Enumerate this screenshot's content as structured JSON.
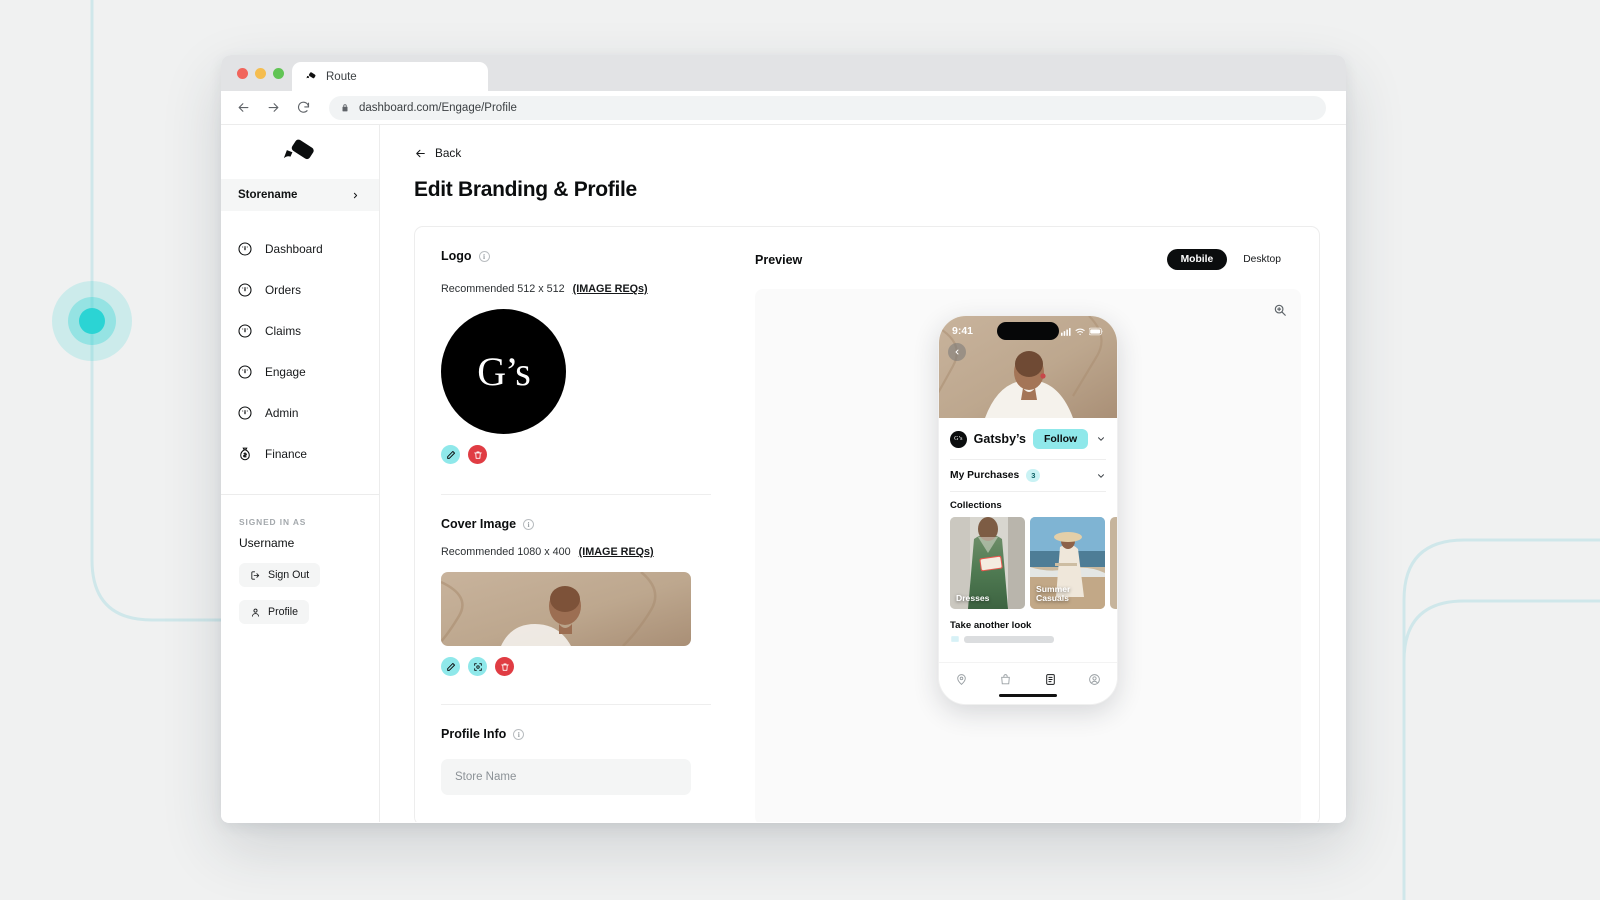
{
  "browser": {
    "tab_title": "Route",
    "tab_favicon": "route-logo-icon",
    "url": "dashboard.com/Engage/Profile",
    "nav": {
      "back": "back-arrow-icon",
      "forward": "forward-arrow-icon",
      "reload": "reload-icon",
      "lock": "lock-icon"
    },
    "traffic_lights": [
      "close",
      "minimize",
      "maximize"
    ]
  },
  "sidebar": {
    "brand_icon": "route-logo-icon",
    "store": {
      "label": "Storename",
      "chevron": "chevron-right-icon"
    },
    "items": [
      {
        "label": "Dashboard",
        "icon": "gauge-icon"
      },
      {
        "label": "Orders",
        "icon": "gauge-icon"
      },
      {
        "label": "Claims",
        "icon": "gauge-icon"
      },
      {
        "label": "Engage",
        "icon": "gauge-icon"
      },
      {
        "label": "Admin",
        "icon": "gauge-icon"
      },
      {
        "label": "Finance",
        "icon": "money-bag-icon"
      }
    ],
    "signed_in_label": "SIGNED IN AS",
    "username": "Username",
    "sign_out": "Sign Out",
    "profile": "Profile"
  },
  "main": {
    "back": "Back",
    "title": "Edit Branding & Profile"
  },
  "logo_section": {
    "title": "Logo",
    "recommended": "Recommended 512 x 512",
    "req_link": "(IMAGE REQs)",
    "logo_text": "G’s",
    "actions": [
      {
        "name": "edit-logo-button",
        "icon": "pencil-icon",
        "color": "#8fe8ea"
      },
      {
        "name": "delete-logo-button",
        "icon": "trash-icon",
        "color": "#e03c43"
      }
    ]
  },
  "cover_section": {
    "title": "Cover Image",
    "recommended": "Recommended 1080 x 400",
    "req_link": "(IMAGE REQs)",
    "actions": [
      {
        "name": "edit-cover-button",
        "icon": "pencil-icon",
        "color": "#8fe8ea"
      },
      {
        "name": "reposition-cover-button",
        "icon": "crop-icon",
        "color": "#8fe8ea"
      },
      {
        "name": "delete-cover-button",
        "icon": "trash-icon",
        "color": "#e03c43"
      }
    ]
  },
  "profile_section": {
    "title": "Profile Info",
    "store_name_placeholder": "Store Name",
    "store_name_value": ""
  },
  "preview": {
    "title": "Preview",
    "toggle": {
      "mobile": "Mobile",
      "desktop": "Desktop",
      "active": "Mobile"
    },
    "zoom_icon": "zoom-in-icon",
    "phone": {
      "status_time": "9:41",
      "status_icons": [
        "cellular-icon",
        "wifi-icon",
        "battery-icon"
      ],
      "back_icon": "chevron-left-icon",
      "store_name": "Gatsby’s",
      "store_badge": "G’s",
      "follow": "Follow",
      "expand_icon": "chevron-down-icon",
      "purchases_label": "My Purchases",
      "purchases_count": "3",
      "collections_label": "Collections",
      "collections": [
        {
          "name": "Dresses"
        },
        {
          "name": "Summer\nCasuals"
        }
      ],
      "take_another_look": "Take another look",
      "tabs": [
        {
          "icon": "location-pin-icon",
          "active": false
        },
        {
          "icon": "shopping-bag-icon",
          "active": false
        },
        {
          "icon": "orders-list-icon",
          "active": true
        },
        {
          "icon": "account-person-icon",
          "active": false
        }
      ]
    }
  },
  "colors": {
    "accent_teal": "#2bd4d4",
    "button_teal": "#8fe8ea",
    "danger_red": "#e03c43",
    "ink": "#0b0d0e",
    "page_bg": "#f0f1f1"
  }
}
